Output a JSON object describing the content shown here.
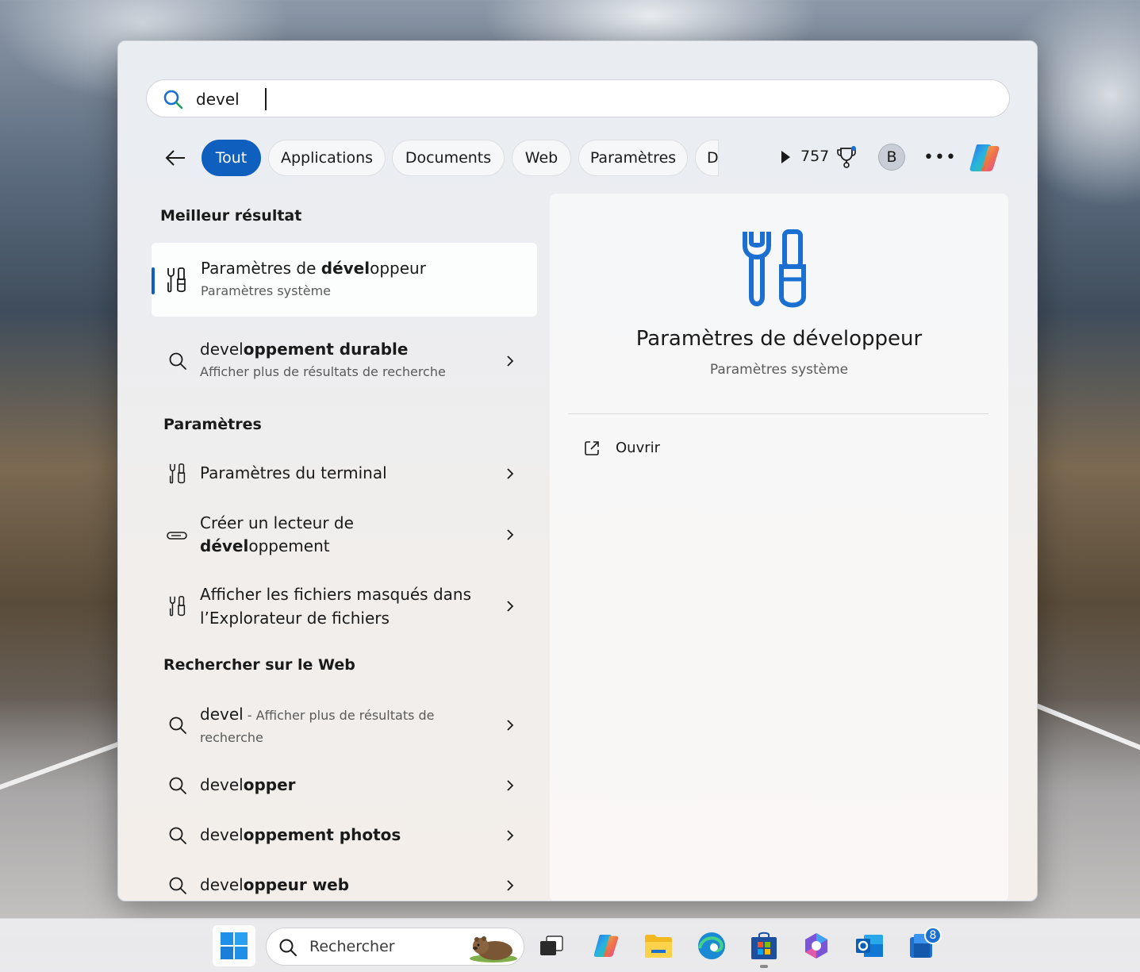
{
  "search": {
    "query": "devel"
  },
  "filters": {
    "back_label": "Retour",
    "chips": [
      "Tout",
      "Applications",
      "Documents",
      "Web",
      "Paramètres",
      "D"
    ],
    "active_chip": "Tout",
    "points": "757",
    "avatar_initial": "B",
    "more_label": "•••"
  },
  "best_result": {
    "section_title": "Meilleur résultat",
    "title_pre": "Paramètres de ",
    "title_bold": "dével",
    "title_post": "oppeur",
    "subtitle": "Paramètres système",
    "icon": "developer-tools-icon"
  },
  "suggestion": {
    "title_bold_prefix": "devel",
    "title_rest": "oppement durable",
    "subtitle": "Afficher plus de résultats de recherche"
  },
  "settings_section": {
    "title": "Paramètres",
    "items": [
      {
        "line1": "Paramètres du terminal",
        "icon": "developer-tools-icon"
      },
      {
        "line1": "Créer un lecteur de",
        "line2_bold": "dével",
        "line2_rest": "oppement",
        "icon": "drive-icon"
      },
      {
        "line1": "Afficher les fichiers masqués dans",
        "line2": "l’Explorateur de fichiers",
        "icon": "developer-tools-icon"
      }
    ]
  },
  "web_section": {
    "title": "Rechercher sur le Web",
    "first": {
      "query": "devel",
      "desc_line1": " - Afficher plus de résultats de",
      "desc_line2": "recherche"
    },
    "items": [
      {
        "bold_prefix": "devel",
        "rest": "opper"
      },
      {
        "bold_prefix": "devel",
        "rest": "oppement photos"
      },
      {
        "bold_prefix": "devel",
        "rest": "oppeur web"
      }
    ]
  },
  "preview": {
    "title": "Paramètres de développeur",
    "subtitle": "Paramètres système",
    "open_label": "Ouvrir"
  },
  "taskbar": {
    "search_label": "Rechercher",
    "apps": [
      "start-icon",
      "task-view-icon",
      "copilot-icon",
      "file-explorer-icon",
      "edge-icon",
      "store-icon",
      "m365-icon",
      "outlook-icon",
      "todo-icon"
    ],
    "notification_count": "8"
  },
  "colors": {
    "accent": "#0f5fbf",
    "icon_blue": "#1b6fd1"
  }
}
